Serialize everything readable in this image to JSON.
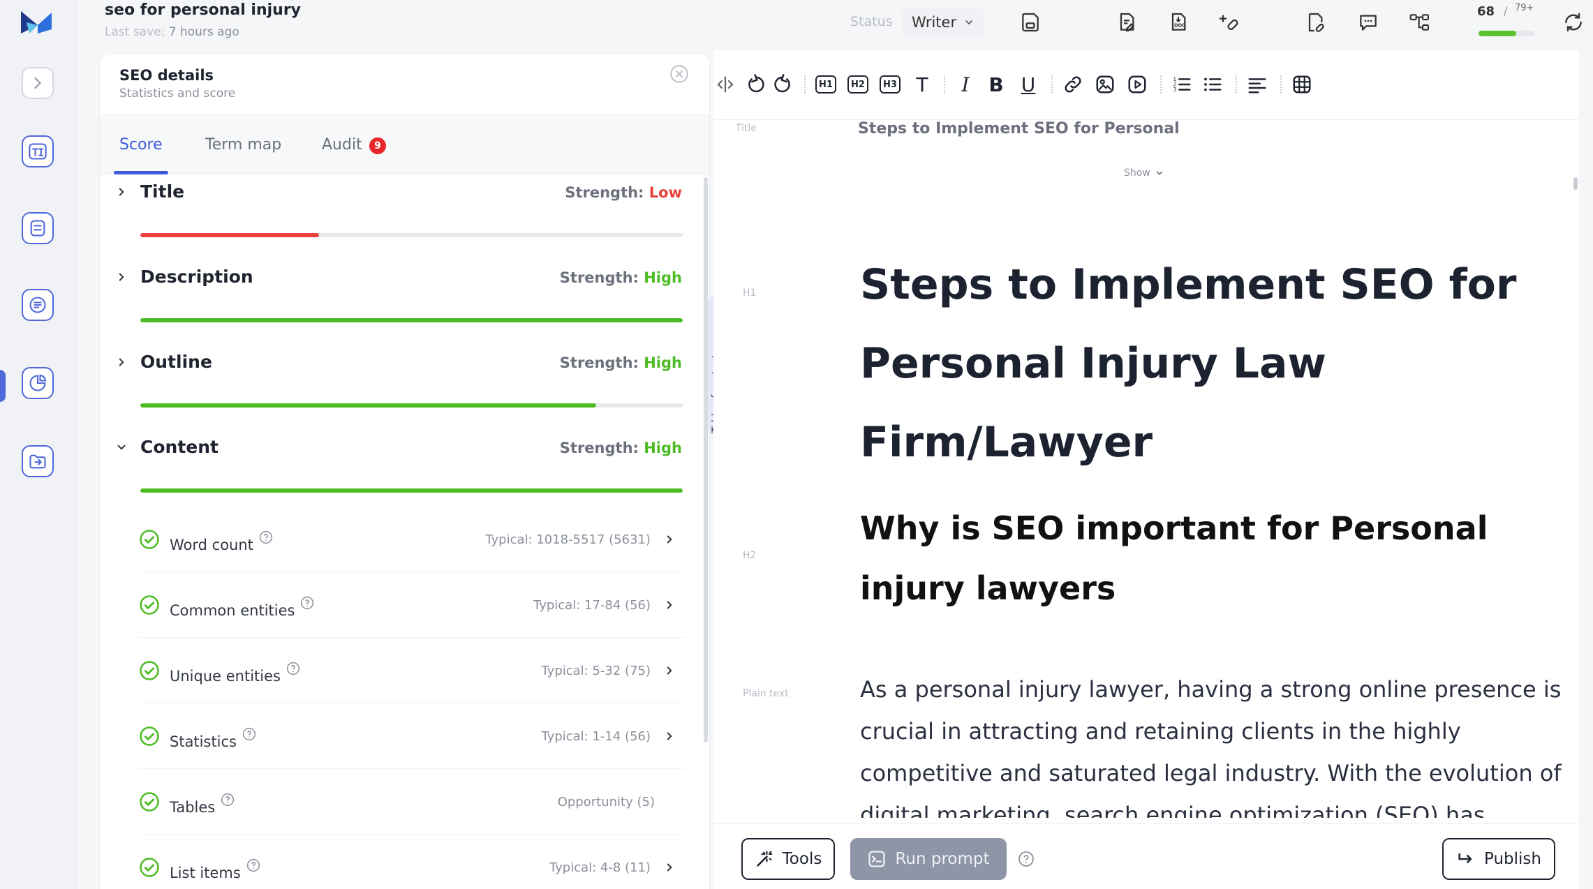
{
  "header": {
    "doc_title": "seo for personal injury",
    "last_save_label": "Last save:",
    "last_save_value": "7 hours ago",
    "status_label": "Status",
    "status_value": "Writer",
    "score": "68",
    "score_sep": "/",
    "score_typical": "79+",
    "score_progress_pct": 68
  },
  "seo_panel": {
    "title": "SEO details",
    "subtitle": "Statistics and score",
    "tabs": [
      {
        "label": "Score"
      },
      {
        "label": "Term map"
      },
      {
        "label": "Audit"
      }
    ],
    "audit_badge": "9",
    "strength_prefix": "Strength:",
    "sections": [
      {
        "name": "Title",
        "strength": "Low",
        "progress_pct": 33
      },
      {
        "name": "Description",
        "strength": "High",
        "progress_pct": 100
      },
      {
        "name": "Outline",
        "strength": "High",
        "progress_pct": 84
      },
      {
        "name": "Content",
        "strength": "High",
        "progress_pct": 100
      }
    ],
    "metrics": [
      {
        "name": "Word count",
        "typical": "Typical:  1018-5517  (5631)"
      },
      {
        "name": "Common entities",
        "typical": "Typical:  17-84  (56)"
      },
      {
        "name": "Unique entities",
        "typical": "Typical:  5-32  (75)"
      },
      {
        "name": "Statistics",
        "typical": "Typical:  1-14  (56)"
      },
      {
        "name": "Tables",
        "typical": "Opportunity  (5)"
      },
      {
        "name": "List items",
        "typical": "Typical:  4-8  (11)"
      }
    ]
  },
  "toc_label": "Table of content",
  "editor": {
    "title_label": "Title",
    "title_value": "Steps to Implement SEO for Personal",
    "show_toggle": "Show",
    "h1_label": "H1",
    "h1_text": "Steps to Implement SEO for Personal Injury Law Firm/Lawyer",
    "h2_label": "H2",
    "h2_text": "Why is SEO important for Personal injury lawyers",
    "p_label": "Plain text",
    "p_text": "As a personal injury lawyer, having a strong online presence is crucial in attracting and retaining clients in the highly competitive and saturated legal industry. With the evolution of digital marketing, search engine optimization (SEO) has emerged as a crucial strategy for improving online visibility and"
  },
  "bottom": {
    "tools_label": "Tools",
    "run_label": "Run prompt",
    "publish_label": "Publish"
  },
  "colors": {
    "accent": "#3d5bd9",
    "low": "#e8403a",
    "high": "#4cbb24"
  }
}
